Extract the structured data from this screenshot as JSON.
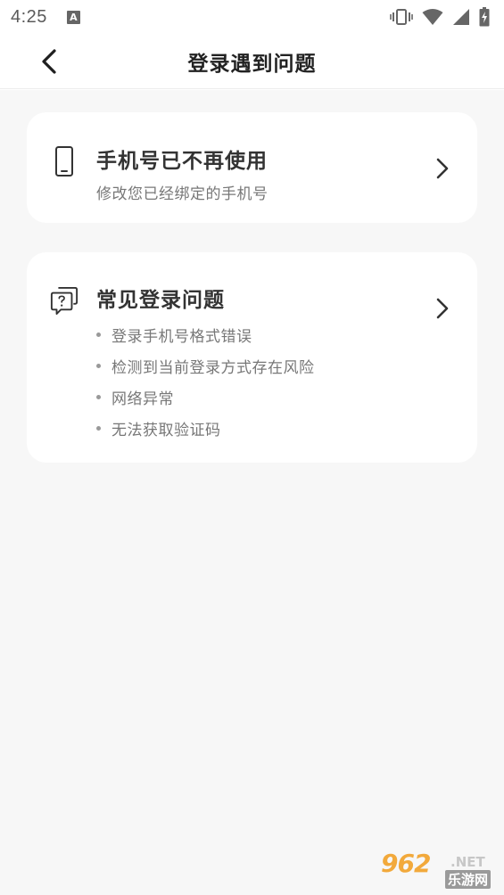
{
  "status_bar": {
    "time": "4:25",
    "notification_icon": "a-notification-icon",
    "icons": [
      "vibrate-icon",
      "wifi-icon",
      "signal-icon",
      "battery-icon"
    ]
  },
  "header": {
    "back_icon": "chevron-left-icon",
    "title": "登录遇到问题"
  },
  "cards": {
    "phone": {
      "icon": "mobile-phone-icon",
      "title": "手机号已不再使用",
      "subtitle": "修改您已经绑定的手机号"
    },
    "faq": {
      "icon": "help-chat-icon",
      "title": "常见登录问题",
      "items": [
        "登录手机号格式错误",
        "检测到当前登录方式存在风险",
        "网络异常",
        "无法获取验证码"
      ]
    }
  },
  "watermark": {
    "main": "962",
    "suffix": ".NET",
    "cn": "乐游网"
  },
  "colors": {
    "background": "#ffffff",
    "content_bg": "#f7f7f7",
    "card_bg": "#ffffff",
    "title_text": "#222222",
    "secondary_text": "#777777",
    "watermark_orange": "#f2a93b"
  }
}
